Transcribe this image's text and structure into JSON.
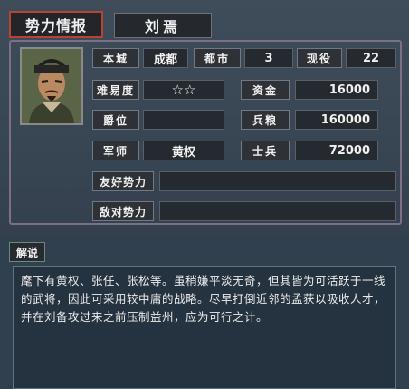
{
  "header": {
    "title": "势力情报",
    "ruler_name": "刘焉"
  },
  "info": {
    "capital_label": "本城",
    "capital_value": "成都",
    "cities_label": "都市",
    "cities_value": "3",
    "officers_label": "现役",
    "officers_value": "22",
    "difficulty_label": "难易度",
    "difficulty_value": "☆☆",
    "funds_label": "资金",
    "funds_value": "16000",
    "rank_label": "爵位",
    "rank_value": "",
    "food_label": "兵粮",
    "food_value": "160000",
    "advisor_label": "军师",
    "advisor_value": "黄权",
    "troops_label": "士兵",
    "troops_value": "72000",
    "friendly_label": "友好势力",
    "friendly_value": "",
    "hostile_label": "敌对势力",
    "hostile_value": ""
  },
  "explanation": {
    "tab_label": "解说",
    "text": "麾下有黄权、张任、张松等。虽稍嫌平淡无奇，但其皆为可活跃于一线的武将，因此可采用较中庸的战略。尽早打倒近邻的孟获以吸收人才，并在刘备攻过来之前压制益州，应为可行之计。"
  },
  "colors": {
    "title_border": "#b5452e",
    "panel": "#3f4d5b"
  }
}
